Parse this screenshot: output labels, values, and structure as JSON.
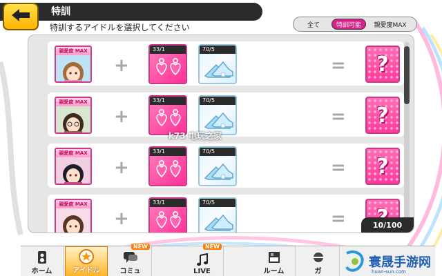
{
  "header": {
    "title": "特訓",
    "subtitle": "特訓するアイドルを選択してください"
  },
  "filter": {
    "tabs": [
      {
        "label": "全て",
        "active": false
      },
      {
        "label": "特訓可能",
        "active": true
      },
      {
        "label": "親愛度MAX",
        "active": false
      }
    ]
  },
  "rows": [
    {
      "badge": "親愛度 MAX",
      "earring_count": "33/1",
      "shoe_count": "70/5",
      "result": "?"
    },
    {
      "badge": "親愛度 MAX",
      "earring_count": "33/1",
      "shoe_count": "70/5",
      "result": "?"
    },
    {
      "badge": "親愛度 MAX",
      "earring_count": "33/1",
      "shoe_count": "70/5",
      "result": "?"
    },
    {
      "badge": "親愛度 MAX",
      "earring_count": "33/1",
      "shoe_count": "70/5",
      "result": "?"
    }
  ],
  "symbols": {
    "plus": "+",
    "equals": "="
  },
  "counter": "10/100",
  "nav": [
    {
      "label": "ホーム",
      "icon": "speaker-icon",
      "new": ""
    },
    {
      "label": "アイドル",
      "icon": "star-icon",
      "new": ""
    },
    {
      "label": "コミュ",
      "icon": "chat-icon",
      "new": "NEW"
    },
    {
      "label": "LIVE",
      "icon": "music-note-icon",
      "new": "NEW"
    },
    {
      "label": "ルーム",
      "icon": "room-icon",
      "new": ""
    },
    {
      "label": "ガ",
      "icon": "gacha-icon",
      "new": ""
    }
  ],
  "watermarks": {
    "center": "k73 电玩之家",
    "corner": "寰晟手游网",
    "corner_sub": "huan-sun.com"
  },
  "colors": {
    "accent_pink": "#d8208a",
    "header_dark": "#2b2b2b",
    "back_yellow": "#ffc81e",
    "active_nav": "#ffb629"
  }
}
